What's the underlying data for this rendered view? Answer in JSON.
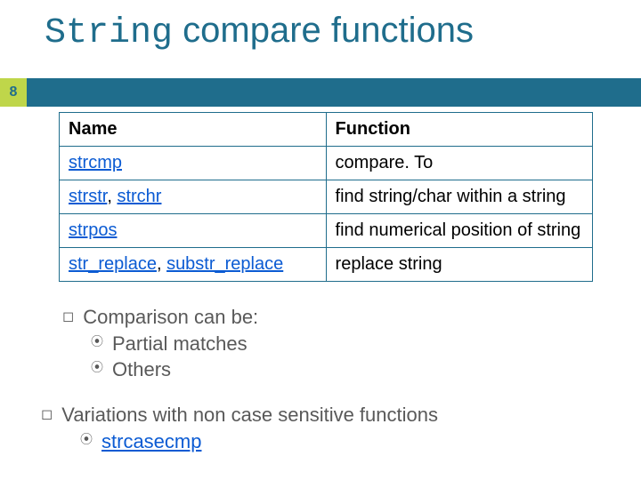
{
  "slide_number": "8",
  "title": {
    "mono": "String",
    "rest": " compare functions"
  },
  "table": {
    "headers": {
      "name": "Name",
      "fn": "Function"
    },
    "rows": [
      {
        "name_links": [
          "strcmp"
        ],
        "fn": "compare. To"
      },
      {
        "name_links": [
          "strstr",
          "strchr"
        ],
        "fn": "find string/char within a string"
      },
      {
        "name_links": [
          "strpos"
        ],
        "fn": "find numerical position of string"
      },
      {
        "name_links": [
          "str_replace",
          "substr_replace"
        ],
        "fn": "replace string"
      }
    ],
    "sep": ",  "
  },
  "overlay": {
    "main": "Comparison can be:",
    "items": [
      "Partial matches",
      "Others"
    ]
  },
  "below": {
    "main": "Variations with non case sensitive functions",
    "items_links": [
      "strcasecmp"
    ]
  }
}
